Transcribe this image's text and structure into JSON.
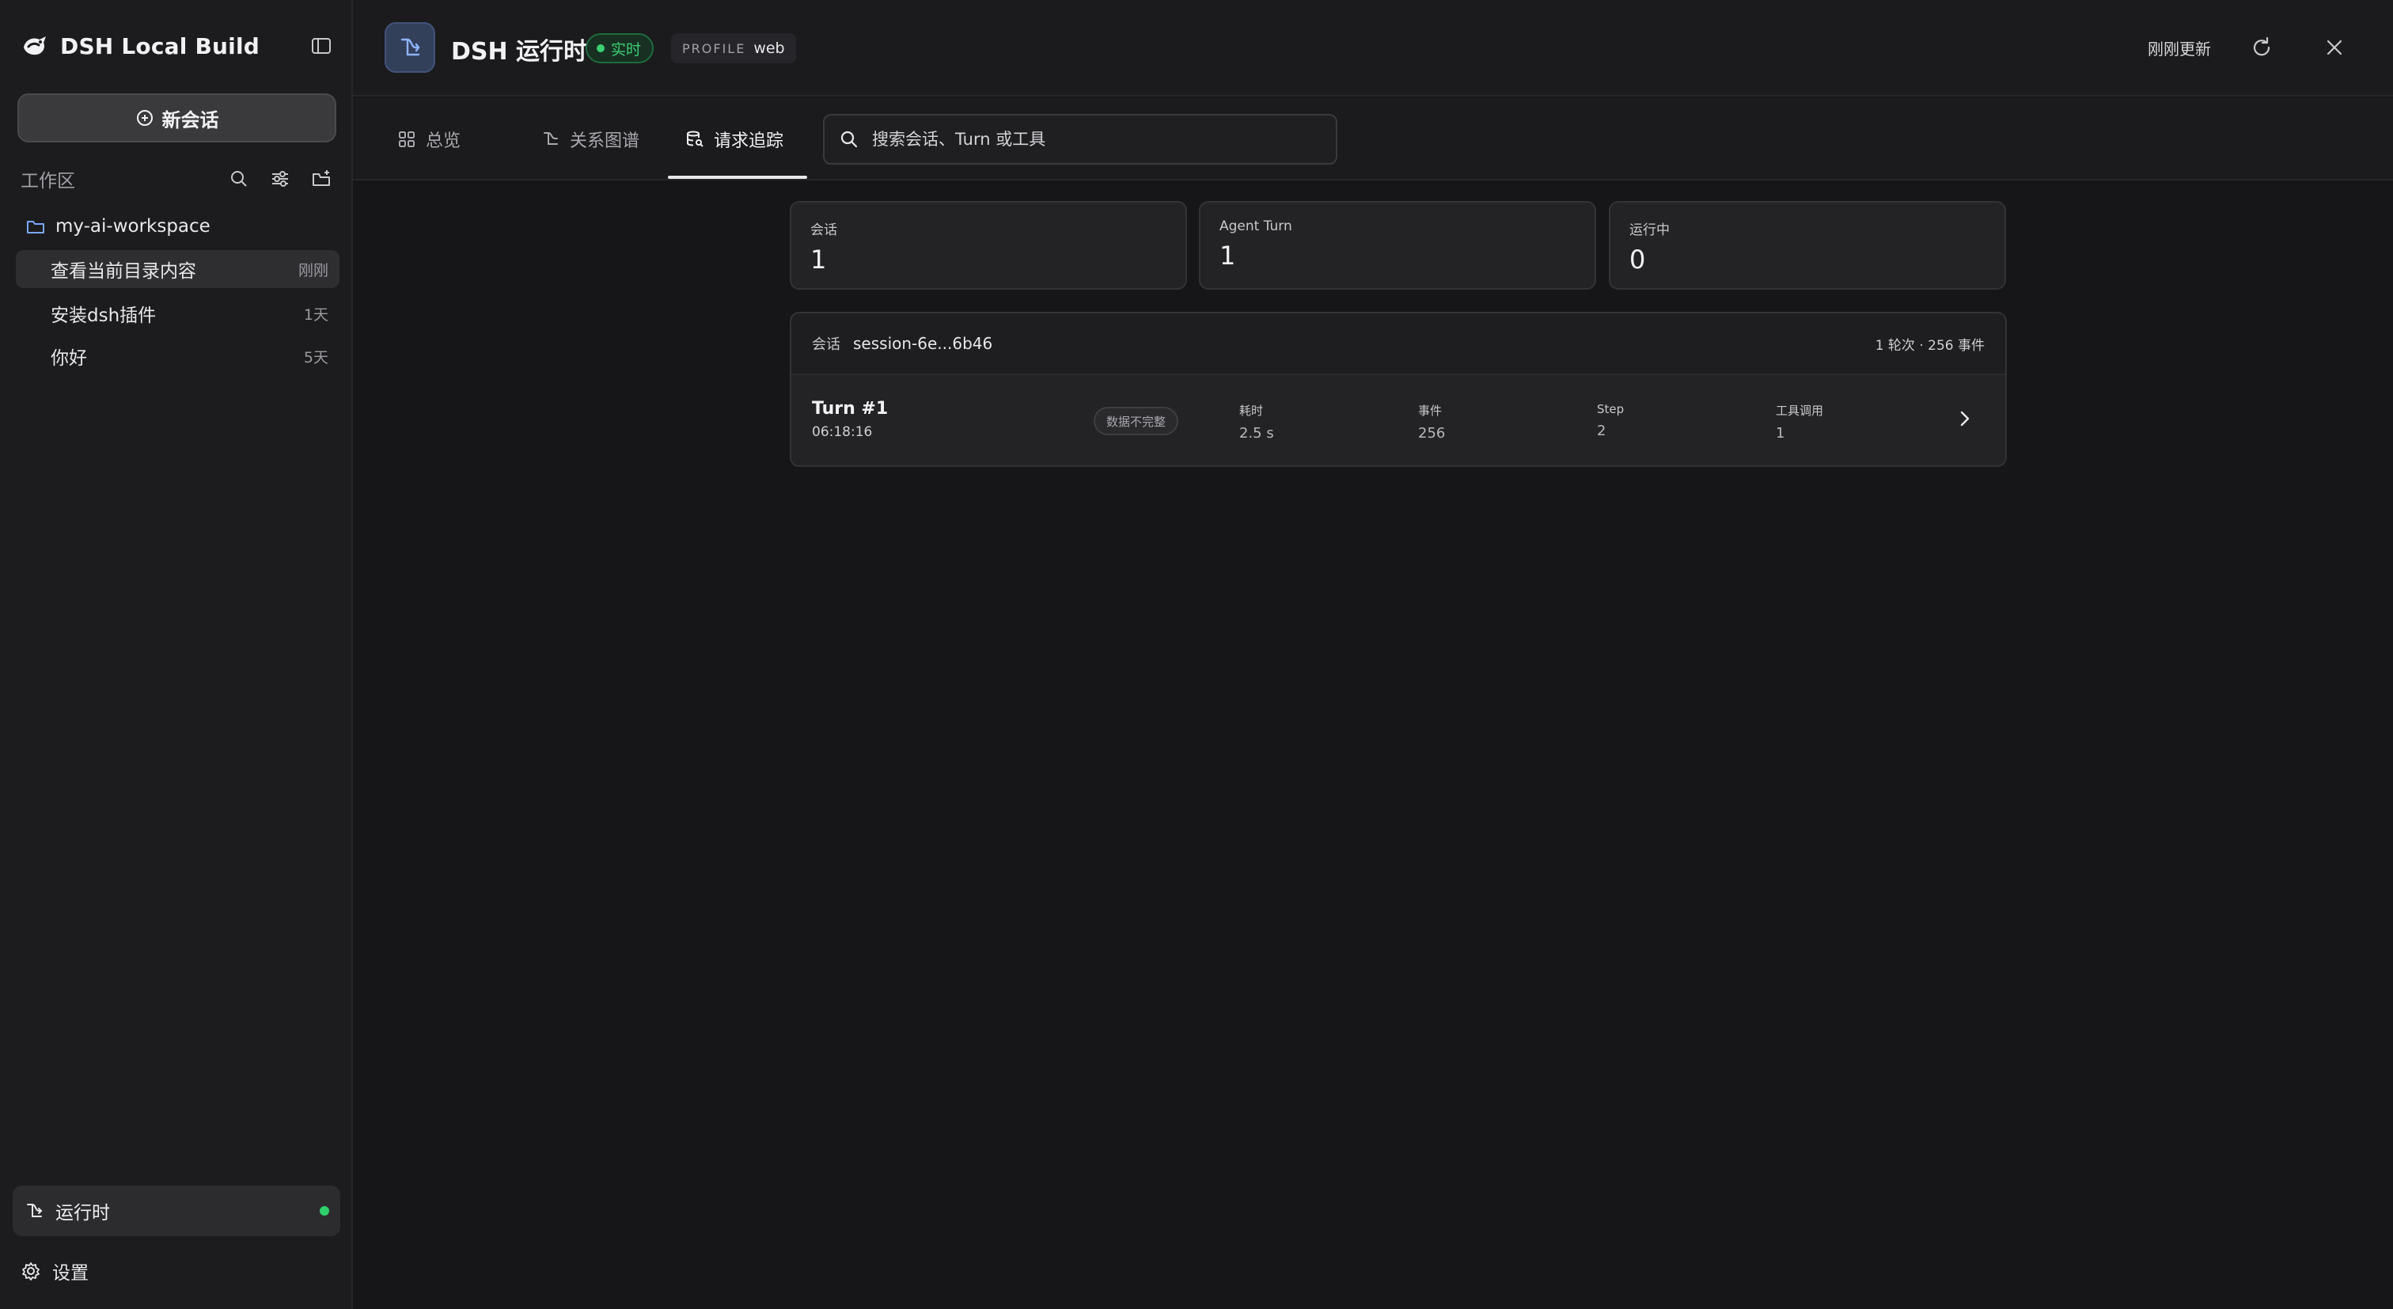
{
  "sidebar": {
    "app_name": "DSH Local Build",
    "new_chat_label": "新会话",
    "workspace_label": "工作区",
    "folder_name": "my-ai-workspace",
    "chats": [
      {
        "title": "查看当前目录内容",
        "time": "刚刚"
      },
      {
        "title": "安装dsh插件",
        "time": "1天"
      },
      {
        "title": "你好",
        "time": "5天"
      }
    ],
    "runtime_label": "运行时",
    "settings_label": "设置"
  },
  "header": {
    "title": "DSH 运行时",
    "live_label": "实时",
    "profile_key": "PROFILE",
    "profile_value": "web",
    "updated_text": "刚刚更新"
  },
  "tabs": [
    {
      "label": "总览"
    },
    {
      "label": "关系图谱"
    },
    {
      "label": "请求追踪"
    }
  ],
  "search": {
    "placeholder": "搜索会话、Turn 或工具"
  },
  "stats": [
    {
      "label": "会话",
      "value": "1"
    },
    {
      "label": "Agent Turn",
      "value": "1"
    },
    {
      "label": "运行中",
      "value": "0"
    }
  ],
  "session": {
    "label": "会话",
    "id": "session-6e...6b46",
    "meta": "1 轮次 · 256 事件",
    "turn": {
      "name": "Turn #1",
      "time": "06:18:16",
      "badge": "数据不完整",
      "metrics": [
        {
          "label": "耗时",
          "value": "2.5 s"
        },
        {
          "label": "事件",
          "value": "256"
        },
        {
          "label": "Step",
          "value": "2"
        },
        {
          "label": "工具调用",
          "value": "1"
        }
      ]
    }
  },
  "colors": {
    "accent_green": "#3ccf73",
    "background": "#161618",
    "sidebar": "#1c1c1e",
    "folder_blue": "#7aa7ff"
  }
}
